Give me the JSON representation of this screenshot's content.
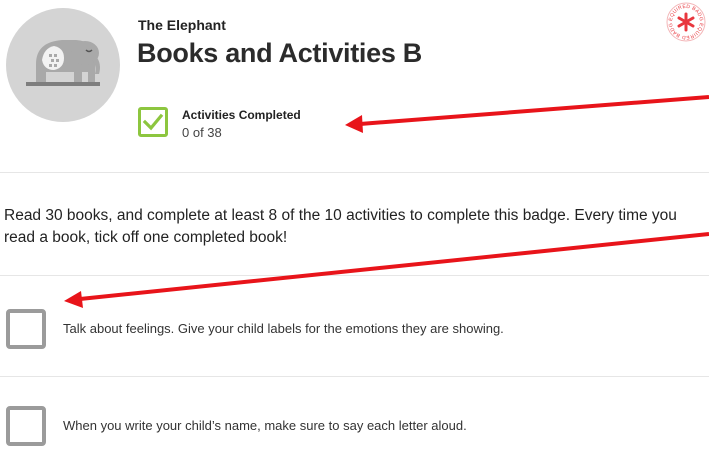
{
  "badge": {
    "icon": "elephant-icon",
    "subtitle": "The Elephant",
    "title": "Books and Activities B",
    "required_badge_text": "REQUIRED BADGE",
    "required_badge_color": "#e8373e"
  },
  "progress": {
    "label": "Activities Completed",
    "value": "0 of 38",
    "completed": 0,
    "total": 38,
    "icon": "checkmark-icon",
    "accent": "#8dc63f"
  },
  "description": "Read 30 books, and complete at least 8 of the 10 activities to complete this badge. Every time you read a book, tick off one completed book!",
  "activities": [
    {
      "text": "Talk about feelings.  Give your child labels for the emotions they are showing.",
      "checked": false
    },
    {
      "text": "When you write your child’s name, make sure to say each letter aloud.",
      "checked": false
    }
  ],
  "annotation_color": "#e8141a"
}
